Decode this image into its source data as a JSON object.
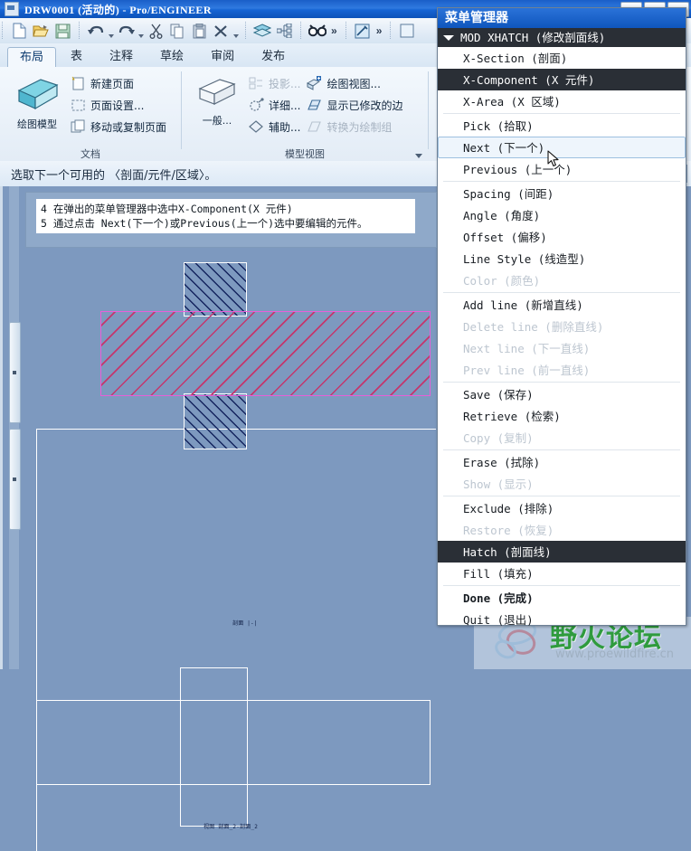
{
  "window": {
    "title": "DRW0001  (活动的)  -  Pro/ENGINEER",
    "icon": "drawing-window-icon"
  },
  "toolbar": {
    "groups": [
      {
        "items": [
          {
            "name": "new-file-icon",
            "label": "新建"
          },
          {
            "name": "open-file-icon",
            "label": "打开"
          },
          {
            "name": "save-file-icon",
            "label": "保存"
          }
        ]
      },
      {
        "items": [
          {
            "name": "undo-icon",
            "label": "撤销"
          },
          {
            "name": "redo-icon",
            "label": "重做"
          },
          {
            "name": "cut-icon",
            "label": "剪切"
          },
          {
            "name": "copy-icon",
            "label": "复制"
          },
          {
            "name": "paste-icon",
            "label": "粘贴"
          },
          {
            "name": "delete-icon",
            "label": "删除"
          }
        ]
      },
      {
        "items": [
          {
            "name": "layers-icon",
            "label": "层"
          },
          {
            "name": "model-tree-icon",
            "label": "模型树"
          }
        ]
      },
      {
        "items": [
          {
            "name": "find-icon",
            "label": "查找"
          },
          {
            "name": "overflow-chevron",
            "label": "»"
          }
        ]
      },
      {
        "items": [
          {
            "name": "sketch-tool-icon",
            "label": "草绘工具"
          },
          {
            "name": "overflow-chevron",
            "label": "»"
          }
        ]
      }
    ]
  },
  "ribbon": {
    "tabs": [
      {
        "label": "布局",
        "active": true
      },
      {
        "label": "表",
        "active": false
      },
      {
        "label": "注释",
        "active": false
      },
      {
        "label": "草绘",
        "active": false
      },
      {
        "label": "审阅",
        "active": false
      },
      {
        "label": "发布",
        "active": false
      }
    ],
    "panels": [
      {
        "title": "文档",
        "big": {
          "label": "绘图模型",
          "icon": "drawing-model-icon"
        },
        "small": [
          {
            "label": "新建页面",
            "icon": "new-page-icon",
            "disabled": false
          },
          {
            "label": "页面设置...",
            "icon": "page-setup-icon",
            "disabled": false
          },
          {
            "label": "移动或复制页面",
            "icon": "move-copy-page-icon",
            "disabled": false
          }
        ]
      },
      {
        "title": "模型视图",
        "big": {
          "label": "一般...",
          "icon": "general-view-icon"
        },
        "small_col1": [
          {
            "label": "投影...",
            "icon": "projection-view-icon",
            "disabled": true
          },
          {
            "label": "详细...",
            "icon": "detailed-view-icon",
            "disabled": false
          },
          {
            "label": "辅助...",
            "icon": "auxiliary-view-icon",
            "disabled": false
          }
        ],
        "small_col2": [
          {
            "label": "绘图视图...",
            "icon": "drawing-view-icon",
            "disabled": false
          },
          {
            "label": "显示已修改的边",
            "icon": "show-modified-edges-icon",
            "disabled": false
          },
          {
            "label": "转换为绘制组",
            "icon": "convert-to-draft-group-icon",
            "disabled": true
          }
        ]
      }
    ]
  },
  "message_line": {
    "text": "选取下一个可用的 〈剖面/元件/区域〉。"
  },
  "note": {
    "lines": [
      "4 在弹出的菜单管理器中选中X-Component(X 元件)",
      "5 通过点击 Next(下一个)或Previous(上一个)选中要编辑的元件。"
    ]
  },
  "drawing": {
    "section_label": "剖面  |-|",
    "bottom_label": "视图 剖面_2-剖面_2",
    "colors": {
      "canvas": "#7d99bf",
      "edge": "#ffffff",
      "hatch_dark": "#14245e",
      "hatch_pink": "#c4366d",
      "hatch_pink_border": "#e85fd8"
    }
  },
  "menu_manager": {
    "title": "菜单管理器",
    "header": "MOD XHATCH  (修改剖面线)",
    "items": [
      {
        "label": "X-Section (剖面)",
        "state": "normal"
      },
      {
        "label": "X-Component  (X 元件)",
        "state": "selected"
      },
      {
        "label": "X-Area (X 区域)",
        "state": "normal"
      },
      {
        "sep": true
      },
      {
        "label": "Pick (拾取)",
        "state": "normal"
      },
      {
        "label": "Next  (下一个)",
        "state": "hover"
      },
      {
        "label": "Previous  (上一个)",
        "state": "normal"
      },
      {
        "sep": true
      },
      {
        "label": "Spacing (间距)",
        "state": "normal"
      },
      {
        "label": "Angle (角度)",
        "state": "normal"
      },
      {
        "label": "Offset (偏移)",
        "state": "normal"
      },
      {
        "label": "Line Style (线造型)",
        "state": "normal"
      },
      {
        "label": "Color (颜色)",
        "state": "disabled"
      },
      {
        "sep": true
      },
      {
        "label": "Add line (新增直线)",
        "state": "normal"
      },
      {
        "label": "Delete line (删除直线)",
        "state": "disabled"
      },
      {
        "label": "Next line (下一直线)",
        "state": "disabled"
      },
      {
        "label": "Prev line (前一直线)",
        "state": "disabled"
      },
      {
        "sep": true
      },
      {
        "label": "Save (保存)",
        "state": "normal"
      },
      {
        "label": "Retrieve (检索)",
        "state": "normal"
      },
      {
        "label": "Copy (复制)",
        "state": "disabled"
      },
      {
        "sep": true
      },
      {
        "label": "Erase (拭除)",
        "state": "normal"
      },
      {
        "label": "Show (显示)",
        "state": "disabled"
      },
      {
        "sep": true
      },
      {
        "label": "Exclude (排除)",
        "state": "normal"
      },
      {
        "label": "Restore (恢复)",
        "state": "disabled"
      },
      {
        "label": "Hatch (剖面线)",
        "state": "selected"
      },
      {
        "label": "Fill (填充)",
        "state": "normal"
      },
      {
        "sep": true
      },
      {
        "label": "Done  (完成)",
        "state": "bold"
      },
      {
        "label": "Quit (退出)",
        "state": "normal"
      }
    ]
  },
  "watermark": {
    "brand": "野火论坛",
    "url": "www.proewildfire.cn",
    "brand_color": "#2f9b3e"
  }
}
